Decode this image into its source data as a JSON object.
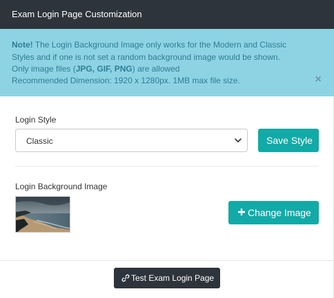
{
  "panel": {
    "title": "Exam Login Page Customization"
  },
  "alert": {
    "note_label": "Note!",
    "line1_rest": " The Login Background Image only works for the Modern and Classic",
    "line2": "Styles and if one is not set a random background image would be shown.",
    "line3_prefix": "Only image files (",
    "line3_types": "JPG, GIF, PNG",
    "line3_suffix": ") are allowed",
    "line4": "Recommended Dimension: 1920 x 1280px. 1MB max file size.",
    "close_symbol": "×"
  },
  "login_style": {
    "label": "Login Style",
    "selected": "Classic",
    "save_label": "Save Style"
  },
  "background": {
    "label": "Login Background Image",
    "change_label": "Change Image"
  },
  "footer": {
    "test_label": "Test Exam Login Page"
  },
  "colors": {
    "header_bg": "#2e343b",
    "alert_bg": "#8dd3e4",
    "alert_text": "#2f7d95",
    "accent": "#12aaa7"
  }
}
